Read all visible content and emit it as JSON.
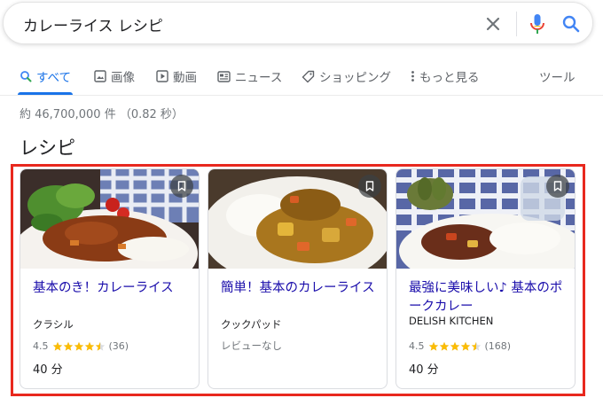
{
  "search": {
    "query": "カレーライス レシピ"
  },
  "tabs": [
    {
      "label": "すべて",
      "active": true
    },
    {
      "label": "画像"
    },
    {
      "label": "動画"
    },
    {
      "label": "ニュース"
    },
    {
      "label": "ショッピング"
    },
    {
      "label": "もっと見る"
    },
    {
      "label": "ツール"
    }
  ],
  "result_stats": "約 46,700,000 件 （0.82 秒）",
  "section_title": "レシピ",
  "recipes": [
    {
      "title": "基本のき！カレーライス",
      "source": "クラシル",
      "rating": "4.5",
      "stars": 4.5,
      "reviews": "(36)",
      "time": "40 分"
    },
    {
      "title": "簡単！基本のカレーライス",
      "source": "クックパッド",
      "no_review": "レビューなし"
    },
    {
      "title": "最強に美味しい♪ 基本のポークカレー",
      "source": "DELISH KITCHEN",
      "rating": "4.5",
      "stars": 4.5,
      "reviews": "(168)",
      "time": "40 分"
    }
  ],
  "colors": {
    "link": "#1a0dab",
    "accent": "#1a73e8",
    "star": "#fbbc04",
    "highlight": "#e8281e"
  }
}
